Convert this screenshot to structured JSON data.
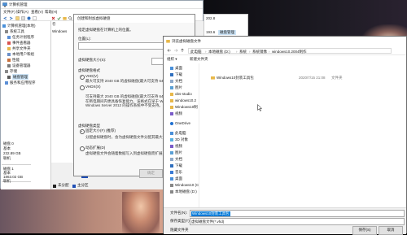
{
  "colors": {
    "selection": "#cce4f7",
    "highlight_text": "#0078d7",
    "disk_bar": "#1f4fb5",
    "folder": "#e8b84a",
    "unallocated": "#222222",
    "primary_partition": "#1f4fb5"
  },
  "computer_management": {
    "title": "计算机管理",
    "menu": [
      "文件(F)",
      "操作(A)",
      "查看(V)",
      "帮助(H)"
    ],
    "toolbar_icons": [
      "back-icon",
      "forward-icon",
      "up-icon",
      "properties-icon",
      "help-icon",
      "delete-icon",
      "check-icon",
      "folder-icon",
      "search-icon",
      "tree-icon"
    ],
    "tree": [
      {
        "label": "计算机管理(本地)",
        "icon": "computer-icon"
      },
      {
        "label": "系统工具",
        "icon": "tools-icon"
      },
      {
        "label": "任务计划程序",
        "icon": "clock-icon"
      },
      {
        "label": "事件查看器",
        "icon": "event-icon"
      },
      {
        "label": "共享文件夹",
        "icon": "folder-icon"
      },
      {
        "label": "本地用户和组",
        "icon": "users-icon"
      },
      {
        "label": "性能",
        "icon": "performance-icon"
      },
      {
        "label": "设备管理器",
        "icon": "device-icon"
      },
      {
        "label": "存储",
        "icon": "storage-icon"
      },
      {
        "label": "磁盘管理",
        "icon": "disk-icon",
        "selected": true
      },
      {
        "label": "服务和应用程序",
        "icon": "services-icon"
      }
    ],
    "volume_list": {
      "header": "卷",
      "row": "Windows"
    },
    "right_panel": {
      "header": "磁盘管理",
      "value_top": "202.8",
      "value_mid": "193.6"
    },
    "disks": [
      {
        "name": "磁盘 0",
        "type": "基本",
        "size": "232.89 GB",
        "status": "联机"
      },
      {
        "name": "磁盘 1",
        "type": "基本",
        "size": "1863.02 GB",
        "status": "联机"
      }
    ],
    "legend": [
      "未分配",
      "主分区"
    ]
  },
  "vhd_dialog": {
    "title": "创建和附加虚拟硬盘",
    "location_prompt": "指定虚拟硬盘在计算机上的位置。",
    "location_label": "位置(L):",
    "browse_label": "浏览(B)...",
    "size_label": "虚拟硬盘大小(S):",
    "size_value": "",
    "size_unit": "MB",
    "format_heading": "虚拟硬盘格式",
    "vhd_option": "VHD(V)",
    "vhd_desc": "最大可支持 2040 GB 的虚拟磁盘(最大可支持 64 TB)。",
    "vhdx_option": "VHDX(X)",
    "vhdx_desc": "可支持最大 2040 GB 的虚拟磁盘(最大可支持 64 TB)。",
    "vhdx_desc2": "在断电期间内更具备恢复能力。该格式在早于 Windows 8 或 Windows Server 2012 的操作系统中不受支持。",
    "type_heading": "虚拟硬盘类型",
    "fixed_option": "固定大小(F) (推荐)",
    "fixed_desc": "分配虚拟硬盘时，会为虚拟硬盘文件分配其最大大小。",
    "dynamic_option": "动态扩展(D)",
    "dynamic_desc": "虚拟硬盘文件会随着数据写入到虚拟硬盘而扩展到最大大小。",
    "ok_label": "确定",
    "cancel_label": "取消"
  },
  "browse_dialog": {
    "title": "浏览虚拟磁盘文件",
    "breadcrumb": [
      "此电脑",
      "本地磁盘 (D:)",
      "系统",
      "系统镜像",
      "windows10.2004制作"
    ],
    "organize_label": "组织 ▾",
    "new_folder_label": "新建文件夹",
    "nav_items": [
      {
        "label": "桌面",
        "icon": "desktop-icon"
      },
      {
        "label": "下载",
        "icon": "download-icon"
      },
      {
        "label": "文档",
        "icon": "document-icon"
      },
      {
        "label": "图片",
        "icon": "picture-icon"
      },
      {
        "label": "obs-studio",
        "icon": "folder-icon"
      },
      {
        "label": "windows10.2",
        "icon": "folder-icon"
      },
      {
        "label": "Windows10制",
        "icon": "folder-icon"
      },
      {
        "label": "视频",
        "icon": "video-icon"
      },
      {
        "label": "OneDrive",
        "icon": "cloud-icon"
      },
      {
        "label": "此电脑",
        "icon": "pc-icon"
      },
      {
        "label": "3D 对象",
        "icon": "cube-icon"
      },
      {
        "label": "视频",
        "icon": "video-icon"
      },
      {
        "label": "图片",
        "icon": "picture-icon"
      },
      {
        "label": "文档",
        "icon": "document-icon"
      },
      {
        "label": "下载",
        "icon": "download-icon"
      },
      {
        "label": "音乐",
        "icon": "music-icon"
      },
      {
        "label": "桌面",
        "icon": "desktop-icon"
      },
      {
        "label": "Windows10 (C",
        "icon": "drive-icon"
      },
      {
        "label": "本地磁盘 (D:)",
        "icon": "drive-icon"
      }
    ],
    "files": [
      {
        "name": "Windows10封装工具包",
        "date": "2020/7/15 21:08",
        "type": "文件夹"
      }
    ],
    "filename_label": "文件名(N):",
    "filename_value": "Windows10封装工具包",
    "filetype_label": "保存类型(T):",
    "filetype_value": "虚拟磁盘文件(*.vhd)",
    "hide_folders_label": "隐藏文件夹",
    "save_label": "保存(S)",
    "cancel_label": "取消"
  }
}
